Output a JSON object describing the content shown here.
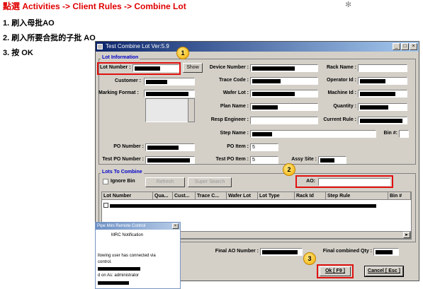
{
  "instructions": {
    "title": "點選 Activities -> Client Rules -> Combine Lot",
    "steps": [
      "1. 刷入母批AO",
      "2. 刷入所要合批的子批 AO",
      "3. 按 OK"
    ]
  },
  "window": {
    "title": "Test Combine Lot  Ver:5.9",
    "controls": {
      "min": "_",
      "max": "□",
      "close": "×"
    }
  },
  "lot_info": {
    "group_label": "Lot Information",
    "lot_number_label": "Lot Number :",
    "show_button": "Show",
    "customer_label": "Customer :",
    "marking_format_label": "Marking Format :",
    "device_number_label": "Device Number :",
    "trace_code_label": "Trace Code :",
    "wafer_lot_label": "Wafer Lot :",
    "plan_name_label": "Plan Name :",
    "resp_engineer_label": "Resp Engineer :",
    "step_name_label": "Step Name :",
    "po_item_label": "PO Item :",
    "po_item_value": "5",
    "test_po_item_label": "Test PO Item :",
    "test_po_item_value": "5",
    "assy_site_label": "Assy Site :",
    "rack_name_label": "Rack Name :",
    "operator_id_label": "Operator Id :",
    "machine_id_label": "Machine Id :",
    "quantity_label": "Quantity :",
    "current_rule_label": "Current Rule :",
    "bin_label": "Bin #:",
    "po_number_label": "PO Number :",
    "test_po_number_label": "Test PO Number :"
  },
  "lots_to_combine": {
    "group_label": "Lots To Combine",
    "ignore_bin_label": "Ignore Bin",
    "refresh_button": "Refresh",
    "super_search_button": "Super Search",
    "ao_label": "AO:",
    "columns": [
      "Lot Number",
      "Qua...",
      "Cust...",
      "Trace C...",
      "Wafer Lot",
      "Lot Type",
      "Rack Id",
      "Step Rule",
      "Bin #"
    ]
  },
  "footer": {
    "final_ao_label": "Final AO Number :",
    "final_qty_label": "Final combined Qty :",
    "ok_button": "Ok [ F9 ]",
    "cancel_button": "Cancel [ Esc ]"
  },
  "callouts": {
    "one": "1",
    "two": "2",
    "three": "3"
  },
  "notification": {
    "title": "Pipe Mini Remote Control",
    "heading": "MRC Notification",
    "line1": "llowing user has connected via",
    "line2": "control.",
    "line3": "d on As: administrator"
  },
  "colors": {
    "accent_red": "#e00000",
    "callout_red": "#e01010",
    "badge_yellow": "#f5b000",
    "title_blue": "#0a246a"
  }
}
